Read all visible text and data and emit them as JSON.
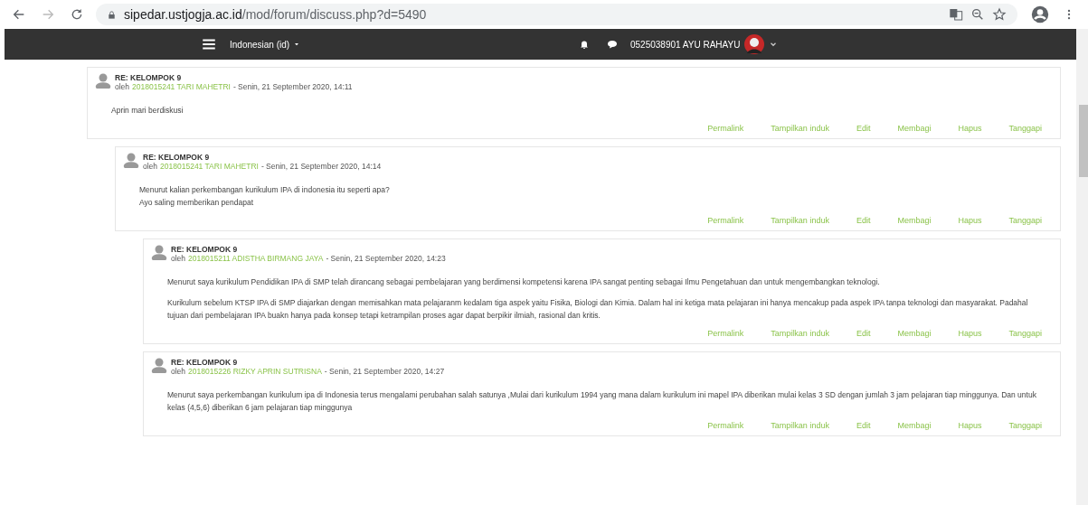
{
  "browser": {
    "url_host": "sipedar.ustjogja.ac.id",
    "url_path": "/mod/forum/discuss.php?d=5490"
  },
  "navbar": {
    "language": "Indonesian (id)",
    "user_name": "0525038901 AYU RAHAYU"
  },
  "posts": [
    {
      "subject": "RE: KELOMPOK 9",
      "by": "oleh",
      "author": "2018015241 TARI MAHETRI",
      "date": "- Senin, 21 September 2020, 14:11",
      "paragraphs": [
        [
          "Aprin mari berdiskusi"
        ]
      ],
      "actions": [
        "Permalink",
        "Tampilkan induk",
        "Edit",
        "Membagi",
        "Hapus",
        "Tanggapi"
      ],
      "children": [
        {
          "subject": "RE: KELOMPOK 9",
          "by": "oleh",
          "author": "2018015241 TARI MAHETRI",
          "date": "- Senin, 21 September 2020, 14:14",
          "paragraphs": [
            [
              "Menurut kalian perkembangan kurikulum IPA di indonesia itu seperti apa?",
              "Ayo saling memberikan pendapat"
            ]
          ],
          "actions": [
            "Permalink",
            "Tampilkan induk",
            "Edit",
            "Membagi",
            "Hapus",
            "Tanggapi"
          ],
          "children": [
            {
              "subject": "RE: KELOMPOK 9",
              "by": "oleh",
              "author": "2018015211 ADISTHA BIRMANG JAYA",
              "date": "- Senin, 21 September 2020, 14:23",
              "paragraphs": [
                [
                  "Menurut saya kurikulum Pendidikan IPA di SMP telah dirancang sebagai pembelajaran yang berdimensi kompetensi karena IPA sangat penting sebagai Ilmu Pengetahuan dan untuk mengembangkan teknologi."
                ],
                [
                  "Kurikulum sebelum KTSP IPA di SMP diajarkan dengan memisahkan mata pelajaranm kedalam tiga aspek yaitu Fisika, Biologi dan Kimia. Dalam hal ini ketiga mata pelajaran ini hanya mencakup pada aspek IPA tanpa teknologi dan masyarakat. Padahal tujuan dari pembelajaran IPA buakn hanya pada konsep tetapi ketrampilan proses agar dapat berpikir ilmiah, rasional dan kritis."
                ]
              ],
              "actions": [
                "Permalink",
                "Tampilkan induk",
                "Edit",
                "Membagi",
                "Hapus",
                "Tanggapi"
              ]
            },
            {
              "subject": "RE: KELOMPOK 9",
              "by": "oleh",
              "author": "2018015226 RIZKY APRIN SUTRISNA",
              "date": "- Senin, 21 September 2020, 14:27",
              "paragraphs": [
                [
                  "Menurut saya perkembangan kurikulum ipa di Indonesia terus mengalami perubahan salah satunya ,Mulai dari kurikulum 1994 yang mana dalam kurikulum ini mapel IPA diberikan mulai kelas 3 SD dengan jumlah 3 jam pelajaran tiap minggunya. Dan untuk kelas (4,5,6) diberikan 6 jam pelajaran tiap minggunya"
                ]
              ],
              "actions": [
                "Permalink",
                "Tampilkan induk",
                "Edit",
                "Membagi",
                "Hapus",
                "Tanggapi"
              ]
            }
          ]
        }
      ]
    }
  ]
}
